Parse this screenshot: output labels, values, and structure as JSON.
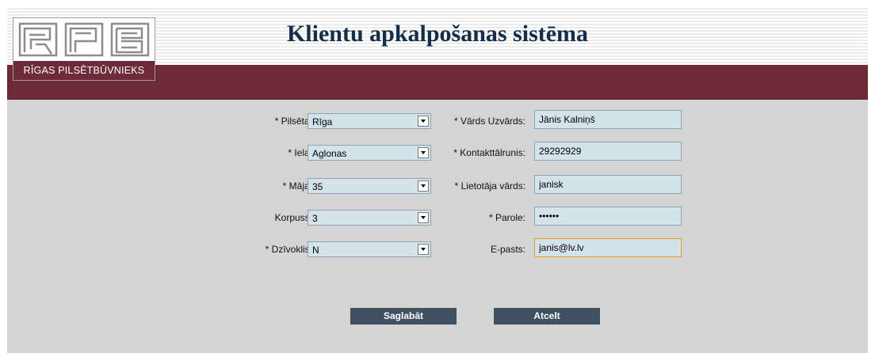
{
  "header": {
    "title": "Klientu apkalpošanas sistēma",
    "logo_text": "RĪGAS PILSĒTBŪVNIEKS"
  },
  "form": {
    "city": {
      "label": "* Pilsēta:",
      "value": "Rīga"
    },
    "street": {
      "label": "* Iela:",
      "value": "Aglonas"
    },
    "house": {
      "label": "* Māja:",
      "value": "35"
    },
    "block": {
      "label": "Korpuss:",
      "value": "3"
    },
    "apartment": {
      "label": "* Dzīvoklis:",
      "value": "N"
    },
    "full_name": {
      "label": "* Vārds Uzvārds:",
      "value": "Jānis Kalniņš"
    },
    "phone": {
      "label": "* Kontakttālrunis:",
      "value": "29292929"
    },
    "username": {
      "label": "* Lietotāja vārds:",
      "value": "janisk"
    },
    "password": {
      "label": "* Parole:",
      "value": "••••••"
    },
    "email": {
      "label": "E-pasts:",
      "value": "janis@lv.lv"
    }
  },
  "actions": {
    "save_label": "Saglabāt",
    "cancel_label": "Atcelt"
  },
  "colors": {
    "maroon": "#6e2a36",
    "panel": "#d4d4d4",
    "field": "#d4e3ea",
    "button": "#3f5060",
    "title": "#142e4a"
  }
}
